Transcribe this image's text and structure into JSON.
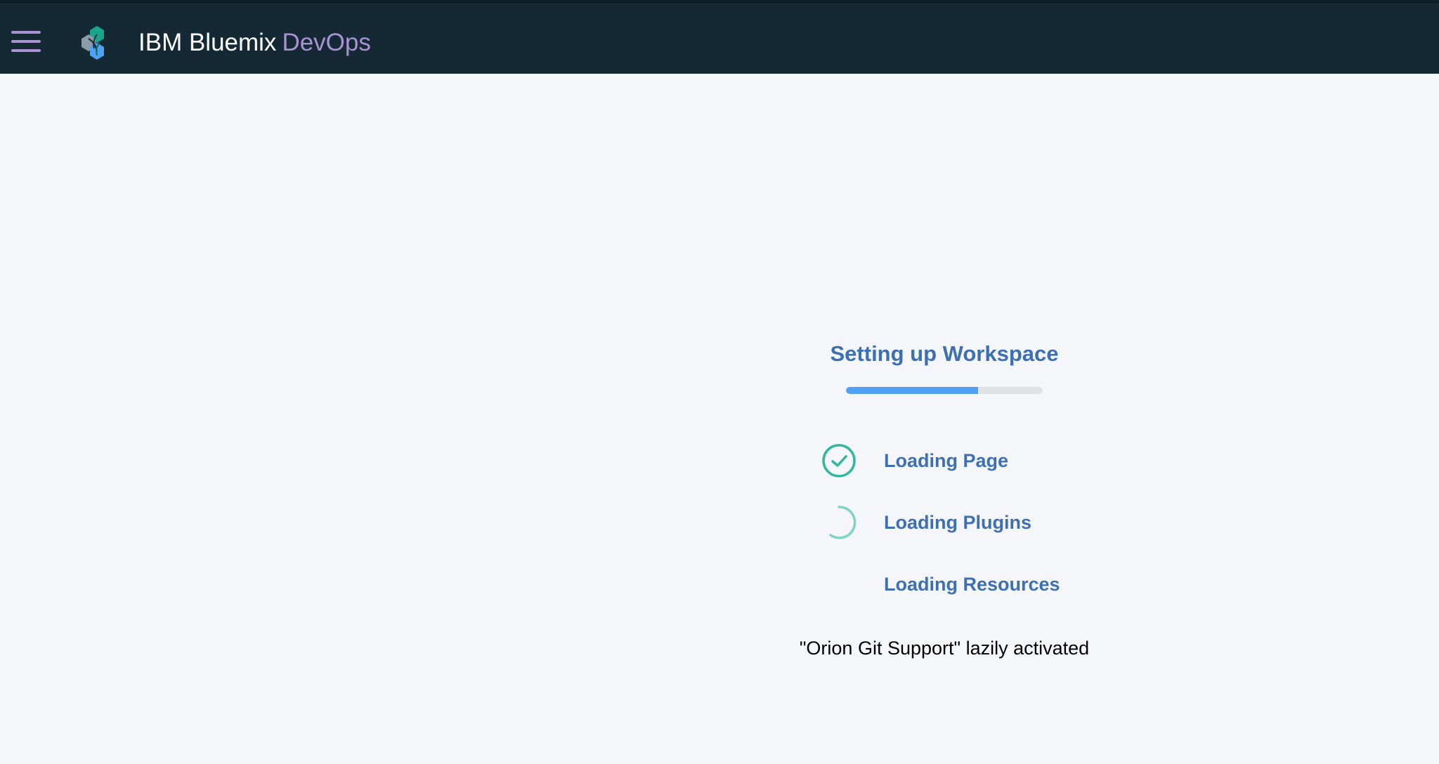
{
  "colors": {
    "header_bg": "#152935",
    "accent_purple": "#a991d4",
    "step_text": "#3d70b2",
    "progress_fill": "#4fa1f5",
    "progress_track": "#dfe3e6",
    "check_green": "#2fb89c",
    "spinner": "#7cd4c6"
  },
  "header": {
    "menu_icon": "hamburger-menu-icon",
    "logo_icon": "bluemix-hexagon-logo-icon",
    "brand_name": "IBM Bluemix",
    "brand_sub": "DevOps"
  },
  "loader": {
    "title": "Setting up Workspace",
    "progress_fraction": 0.67,
    "steps": [
      {
        "label": "Loading Page",
        "status": "done",
        "icon": "check-circle-icon"
      },
      {
        "label": "Loading Plugins",
        "status": "in-progress",
        "icon": "spinner-icon"
      },
      {
        "label": "Loading Resources",
        "status": "pending",
        "icon": ""
      }
    ],
    "status_message": "\"Orion Git Support\" lazily activated"
  }
}
